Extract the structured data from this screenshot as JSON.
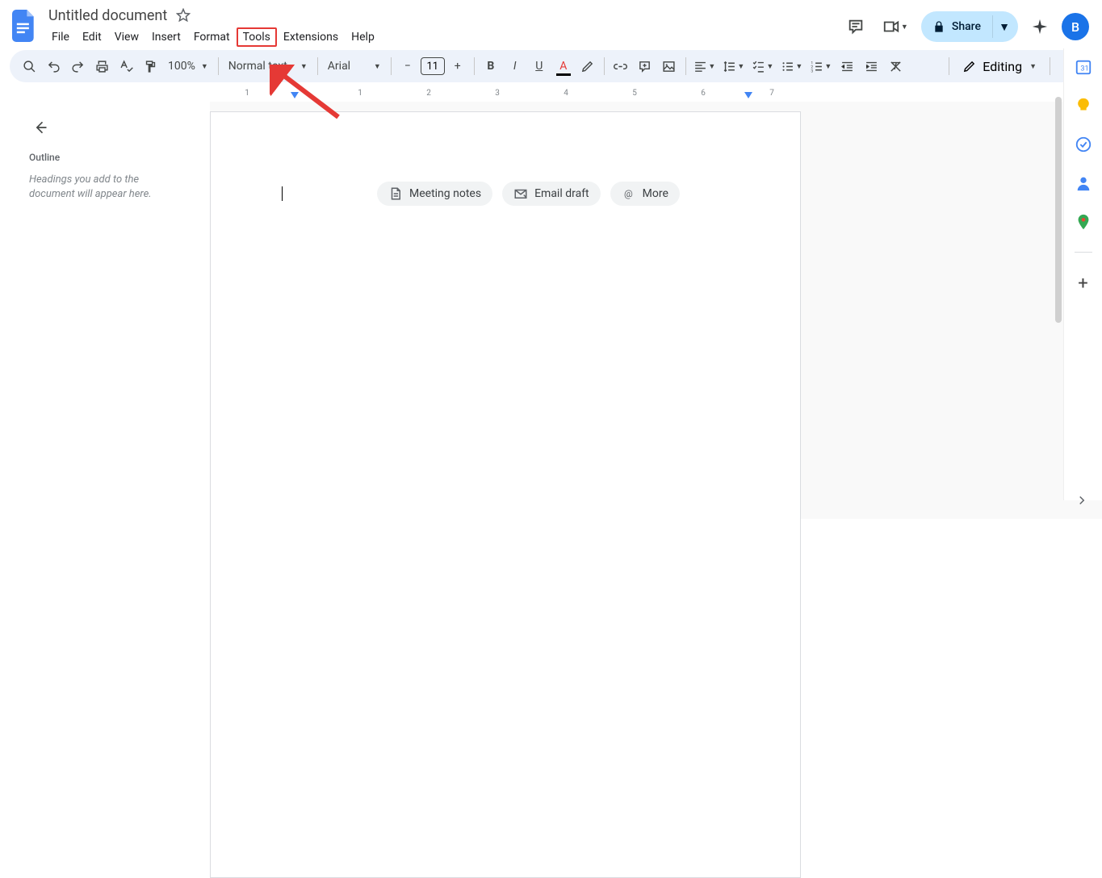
{
  "header": {
    "doc_title": "Untitled document",
    "menus": [
      "File",
      "Edit",
      "View",
      "Insert",
      "Format",
      "Tools",
      "Extensions",
      "Help"
    ],
    "highlighted_menu_index": 5,
    "share_label": "Share",
    "avatar_letter": "B"
  },
  "toolbar": {
    "zoom": "100%",
    "style": "Normal text",
    "font": "Arial",
    "font_size": "11",
    "mode_label": "Editing"
  },
  "outline": {
    "title": "Outline",
    "empty_text": "Headings you add to the document will appear here."
  },
  "chips": {
    "meeting": "Meeting notes",
    "email": "Email draft",
    "more": "More"
  },
  "ruler": {
    "numbers": [
      "1",
      "1",
      "2",
      "3",
      "4",
      "5",
      "6",
      "7"
    ]
  },
  "icons": {
    "star": "star-icon",
    "comments": "comments-icon",
    "video": "video-icon",
    "gemini": "gemini-icon"
  }
}
